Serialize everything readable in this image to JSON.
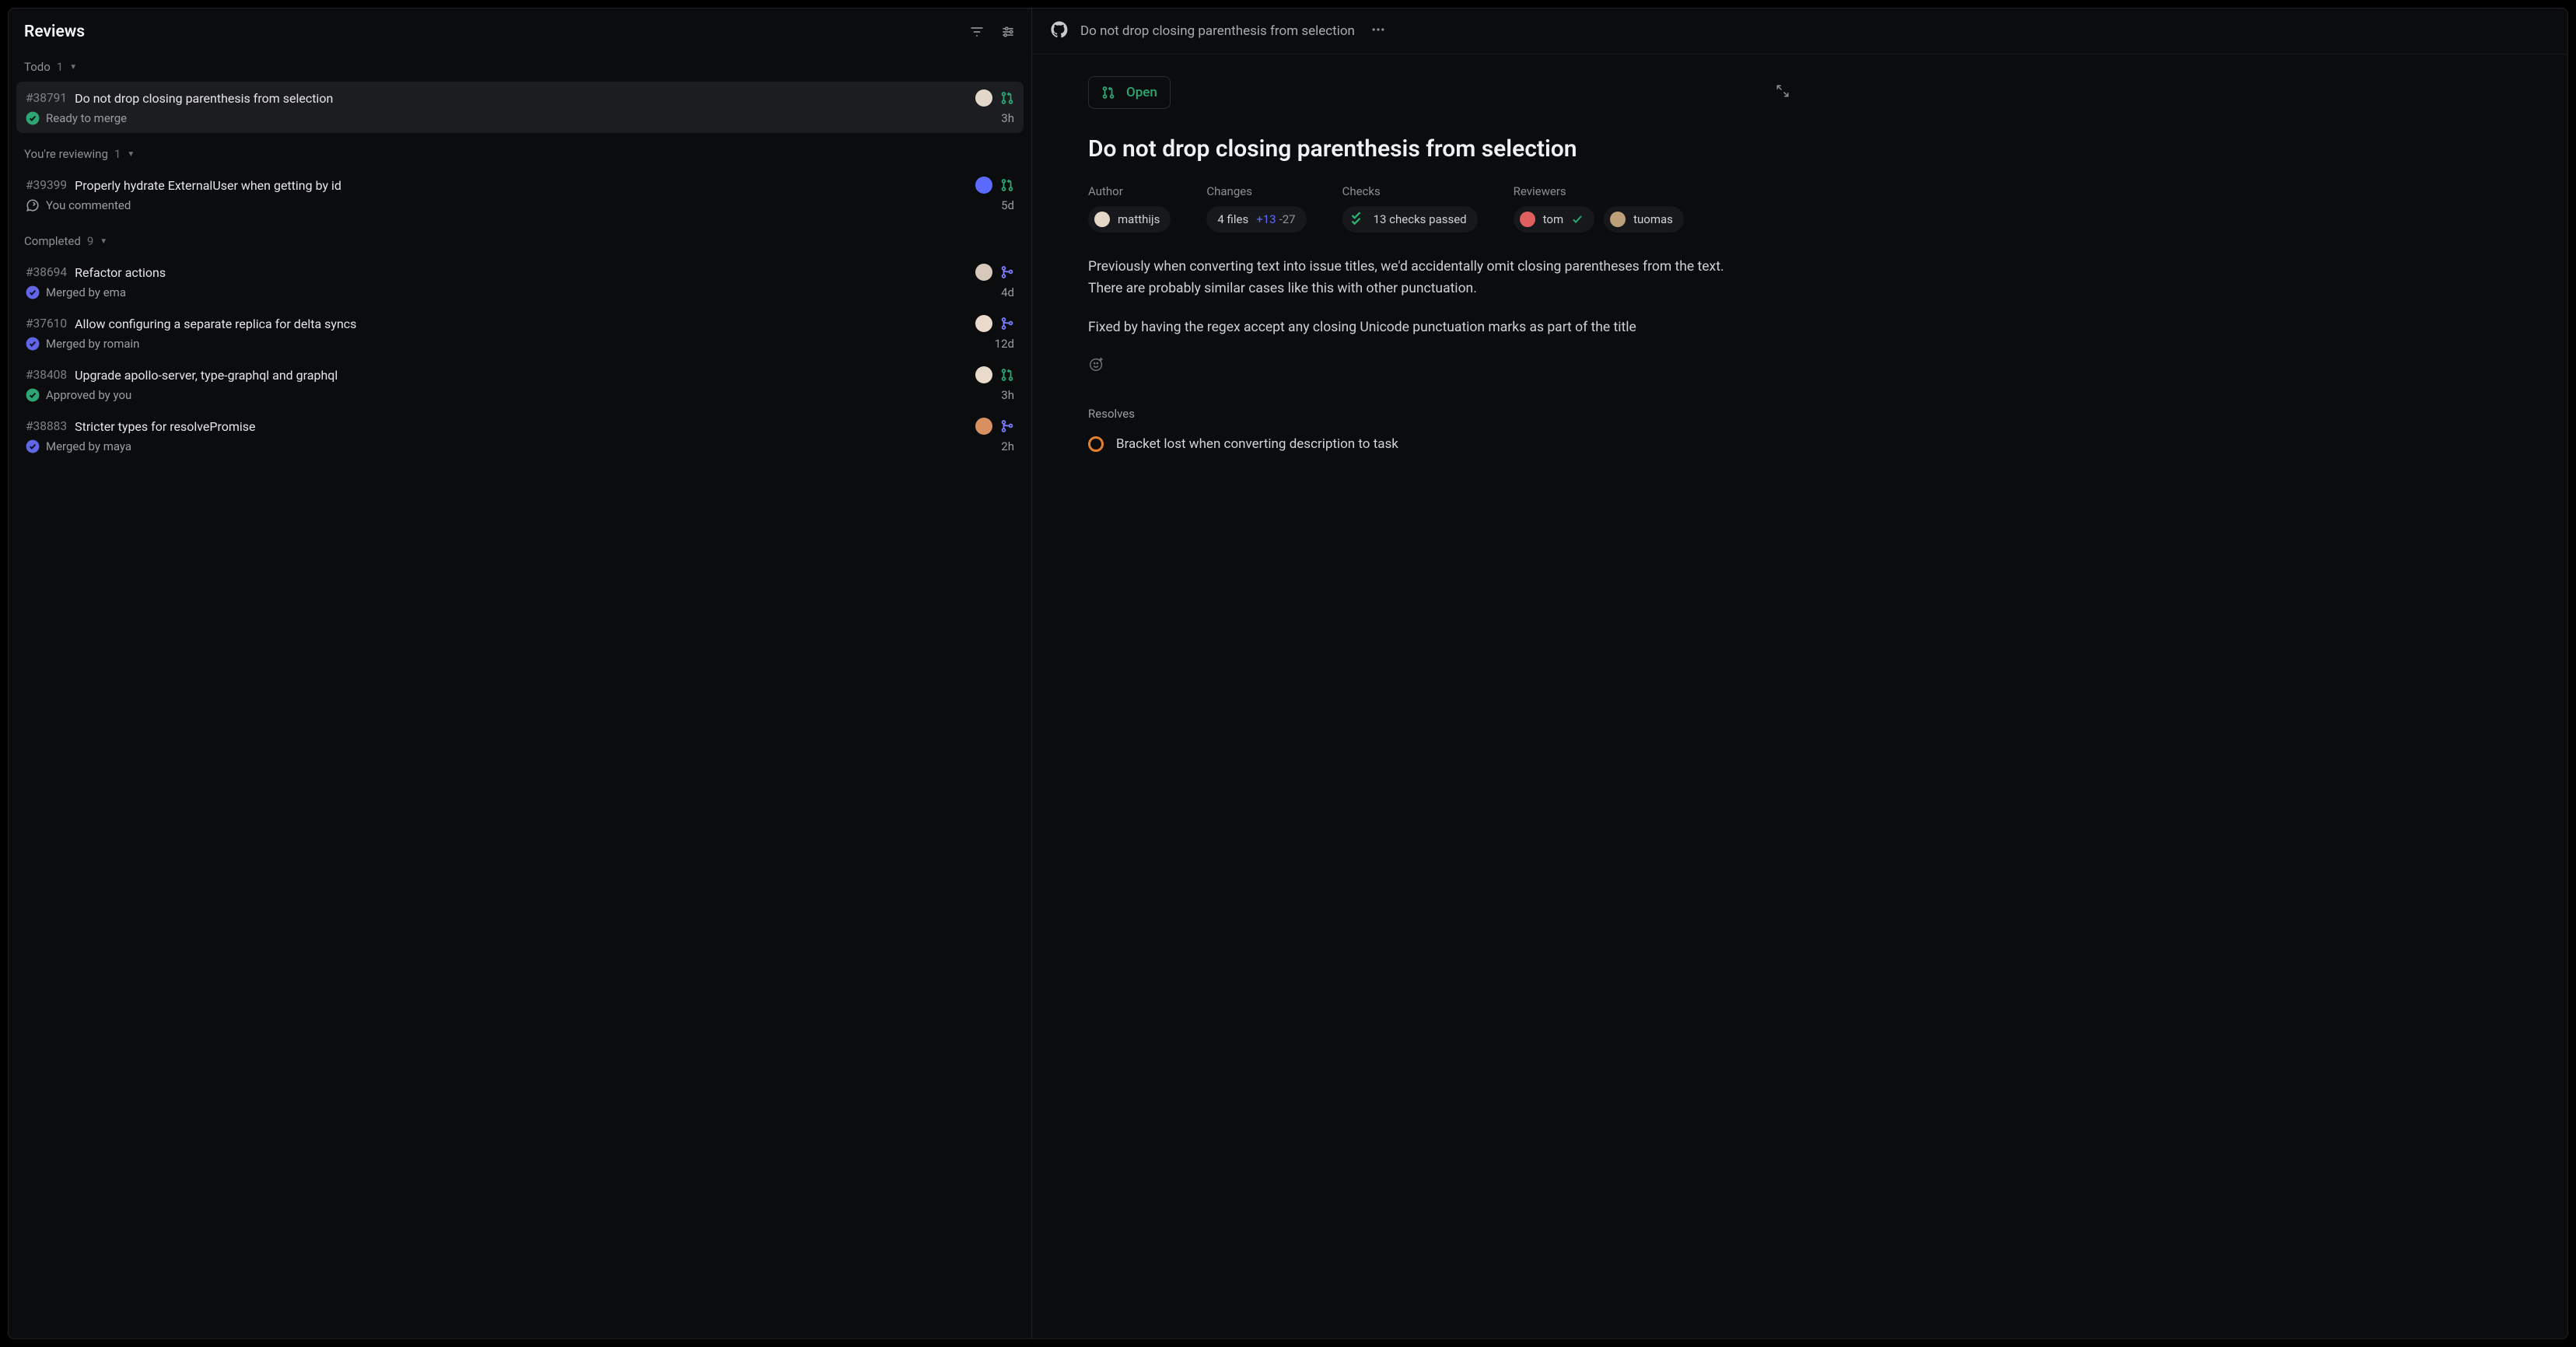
{
  "sidebar": {
    "title": "Reviews",
    "sections": [
      {
        "label": "Todo",
        "count": "1"
      },
      {
        "label": "You're reviewing",
        "count": "1"
      },
      {
        "label": "Completed",
        "count": "9"
      }
    ]
  },
  "prs": {
    "todo": [
      {
        "id": "#38791",
        "title": "Do not drop closing parenthesis from selection",
        "status": "Ready to merge",
        "statusKind": "ready",
        "time": "3h",
        "prKind": "open",
        "author": "matthijs",
        "avatar": "#e3d7c9"
      }
    ],
    "reviewing": [
      {
        "id": "#39399",
        "title": "Properly hydrate ExternalUser when getting by id",
        "status": "You commented",
        "statusKind": "comment",
        "time": "5d",
        "prKind": "open",
        "author": "user",
        "avatar": "#5c6bff"
      }
    ],
    "completed": [
      {
        "id": "#38694",
        "title": "Refactor actions",
        "status": "Merged by ema",
        "statusKind": "merged",
        "time": "4d",
        "prKind": "merged",
        "author": "ema",
        "avatar": "#d6c9bb"
      },
      {
        "id": "#37610",
        "title": "Allow configuring a separate replica for delta syncs",
        "status": "Merged by romain",
        "statusKind": "merged",
        "time": "12d",
        "prKind": "merged",
        "author": "romain",
        "avatar": "#e9dbcb"
      },
      {
        "id": "#38408",
        "title": "Upgrade apollo-server, type-graphql and graphql",
        "status": "Approved by you",
        "statusKind": "ready",
        "time": "3h",
        "prKind": "open",
        "author": "user",
        "avatar": "#e9dbcb"
      },
      {
        "id": "#38883",
        "title": "Stricter types for resolvePromise",
        "status": "Merged by maya",
        "statusKind": "merged",
        "time": "2h",
        "prKind": "merged",
        "author": "maya",
        "avatar": "#d89060"
      }
    ]
  },
  "detail": {
    "headerTitle": "Do not drop closing parenthesis from selection",
    "statusLabel": "Open",
    "title": "Do not drop closing parenthesis from selection",
    "meta": {
      "authorLabel": "Author",
      "author": "matthijs",
      "changesLabel": "Changes",
      "files": "4 files",
      "plus": "+13",
      "minus": "-27",
      "checksLabel": "Checks",
      "checksText": "13 checks passed",
      "reviewersLabel": "Reviewers",
      "reviewers": [
        {
          "name": "tom",
          "avatar": "#e06060",
          "approved": true
        },
        {
          "name": "tuomas",
          "avatar": "#bda07a",
          "approved": false
        }
      ]
    },
    "body": {
      "p1": "Previously when converting text into issue titles, we'd accidentally omit closing parentheses from the text. There are probably similar cases like this with other punctuation.",
      "p2": "Fixed by having the regex accept any closing Unicode punctuation marks as part of the title"
    },
    "resolves": {
      "label": "Resolves",
      "item": "Bracket lost when converting description to task"
    }
  }
}
